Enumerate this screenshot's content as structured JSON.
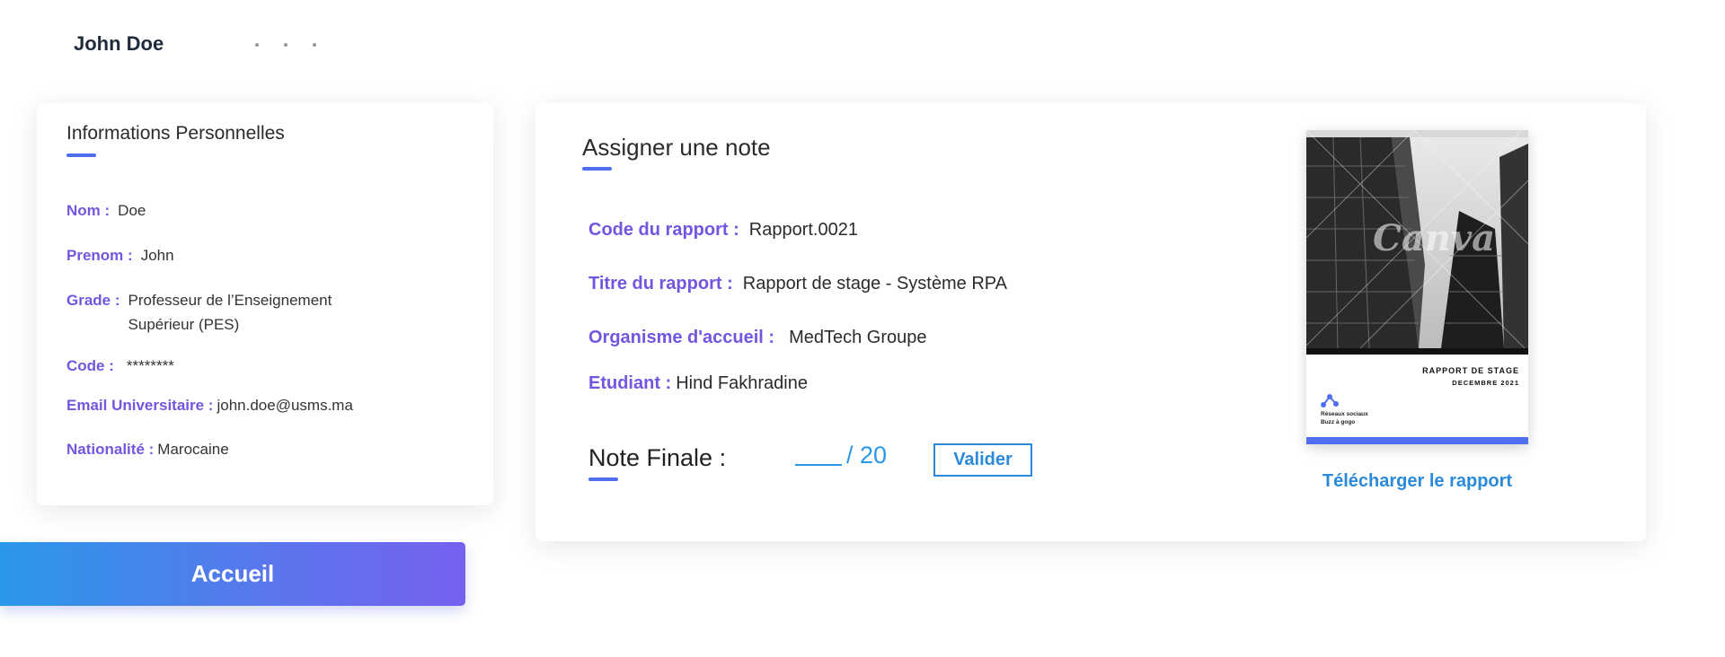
{
  "header": {
    "user_name": "John Doe"
  },
  "info": {
    "title": "Informations Personnelles",
    "rows": [
      {
        "label": "Nom :",
        "value": "Doe"
      },
      {
        "label": "Prenom :",
        "value": "John"
      },
      {
        "label": "Grade :",
        "value": "Professeur de l’Enseignement Supérieur (PES)"
      },
      {
        "label": "Code :",
        "value": "********"
      },
      {
        "label": "Email Universitaire :",
        "value": "john.doe@usms.ma"
      },
      {
        "label": "Nationalité :",
        "value": "Marocaine"
      }
    ]
  },
  "nav": {
    "home_label": "Accueil"
  },
  "grade": {
    "title": "Assigner une note",
    "rows": [
      {
        "label": "Code du rapport :",
        "value": "Rapport.0021"
      },
      {
        "label": "Titre du rapport :",
        "value": "Rapport de stage - Système RPA"
      },
      {
        "label": "Organisme d'accueil :",
        "value": "MedTech Groupe"
      },
      {
        "label": "Etudiant :",
        "value": "Hind Fakhradine"
      }
    ],
    "note_label": "Note Finale :",
    "note_value": "",
    "note_max": "/ 20",
    "validate_label": "Valider"
  },
  "report": {
    "watermark": "Canva",
    "cover_title": "RAPPORT DE STAGE",
    "cover_date": "DECEMBRE 2021",
    "cover_line1": "Réseaux sociaux",
    "cover_line2": "Buzz à gogo",
    "download_label": "Télécharger le rapport"
  },
  "colors": {
    "accent": "#7256e0",
    "link": "#2a89d8",
    "underline": "#4d6ff0"
  }
}
